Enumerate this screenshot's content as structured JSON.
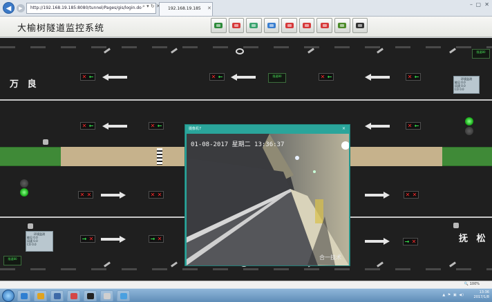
{
  "browser": {
    "address": "http://192.168.19.185:8080/tunnel/Pages/gis/login.do",
    "tab_title": "192.168.19.185",
    "window_controls": [
      "–",
      "▢",
      "✕"
    ]
  },
  "app": {
    "title": "大榆树隧道监控系统",
    "toolbar": [
      {
        "name": "vehicle-detector",
        "color": "#2e8b3a"
      },
      {
        "name": "fan",
        "color": "#d6393a"
      },
      {
        "name": "lighting",
        "color": "#3aa36f"
      },
      {
        "name": "camera",
        "color": "#3b7fd0"
      },
      {
        "name": "alarm",
        "color": "#d6393a"
      },
      {
        "name": "fire",
        "color": "#d6393a"
      },
      {
        "name": "emergency-phone",
        "color": "#d6393a"
      },
      {
        "name": "layers",
        "color": "#4c8b2a"
      },
      {
        "name": "info-board",
        "color": "#333333"
      }
    ]
  },
  "map": {
    "place_left": "万 良",
    "place_right": "抚 松",
    "panel_left": {
      "title": "环境监测",
      "rows": [
        "能见 0.0",
        "风速 0.0",
        "CO 0.0"
      ]
    },
    "panel_right": {
      "title": "环境监测",
      "rows": [
        "能见 0.0",
        "风速 0.0",
        "CO 0.0"
      ]
    },
    "vms_text": "限速80"
  },
  "popup": {
    "title": "摄像机7",
    "close": "×",
    "osd_time": "01-08-2017 星期二 13:36:37",
    "osd_location": "合一技术"
  },
  "statusbar": {
    "zoom": "🔍 100%"
  },
  "taskbar": {
    "apps": [
      {
        "name": "ie",
        "color": "#2f7fd1"
      },
      {
        "name": "chrome",
        "color": "#e0a31f"
      },
      {
        "name": "tools",
        "color": "#3d6aa8"
      },
      {
        "name": "player",
        "color": "#d44747"
      },
      {
        "name": "terminal",
        "color": "#222222"
      },
      {
        "name": "explorer",
        "color": "#cfcfcf"
      },
      {
        "name": "browser",
        "color": "#4aa0e0"
      }
    ],
    "tray_icons": "▲ ⚑ ▣ ◀)",
    "clock": "13:36",
    "date": "2017/1/8"
  }
}
